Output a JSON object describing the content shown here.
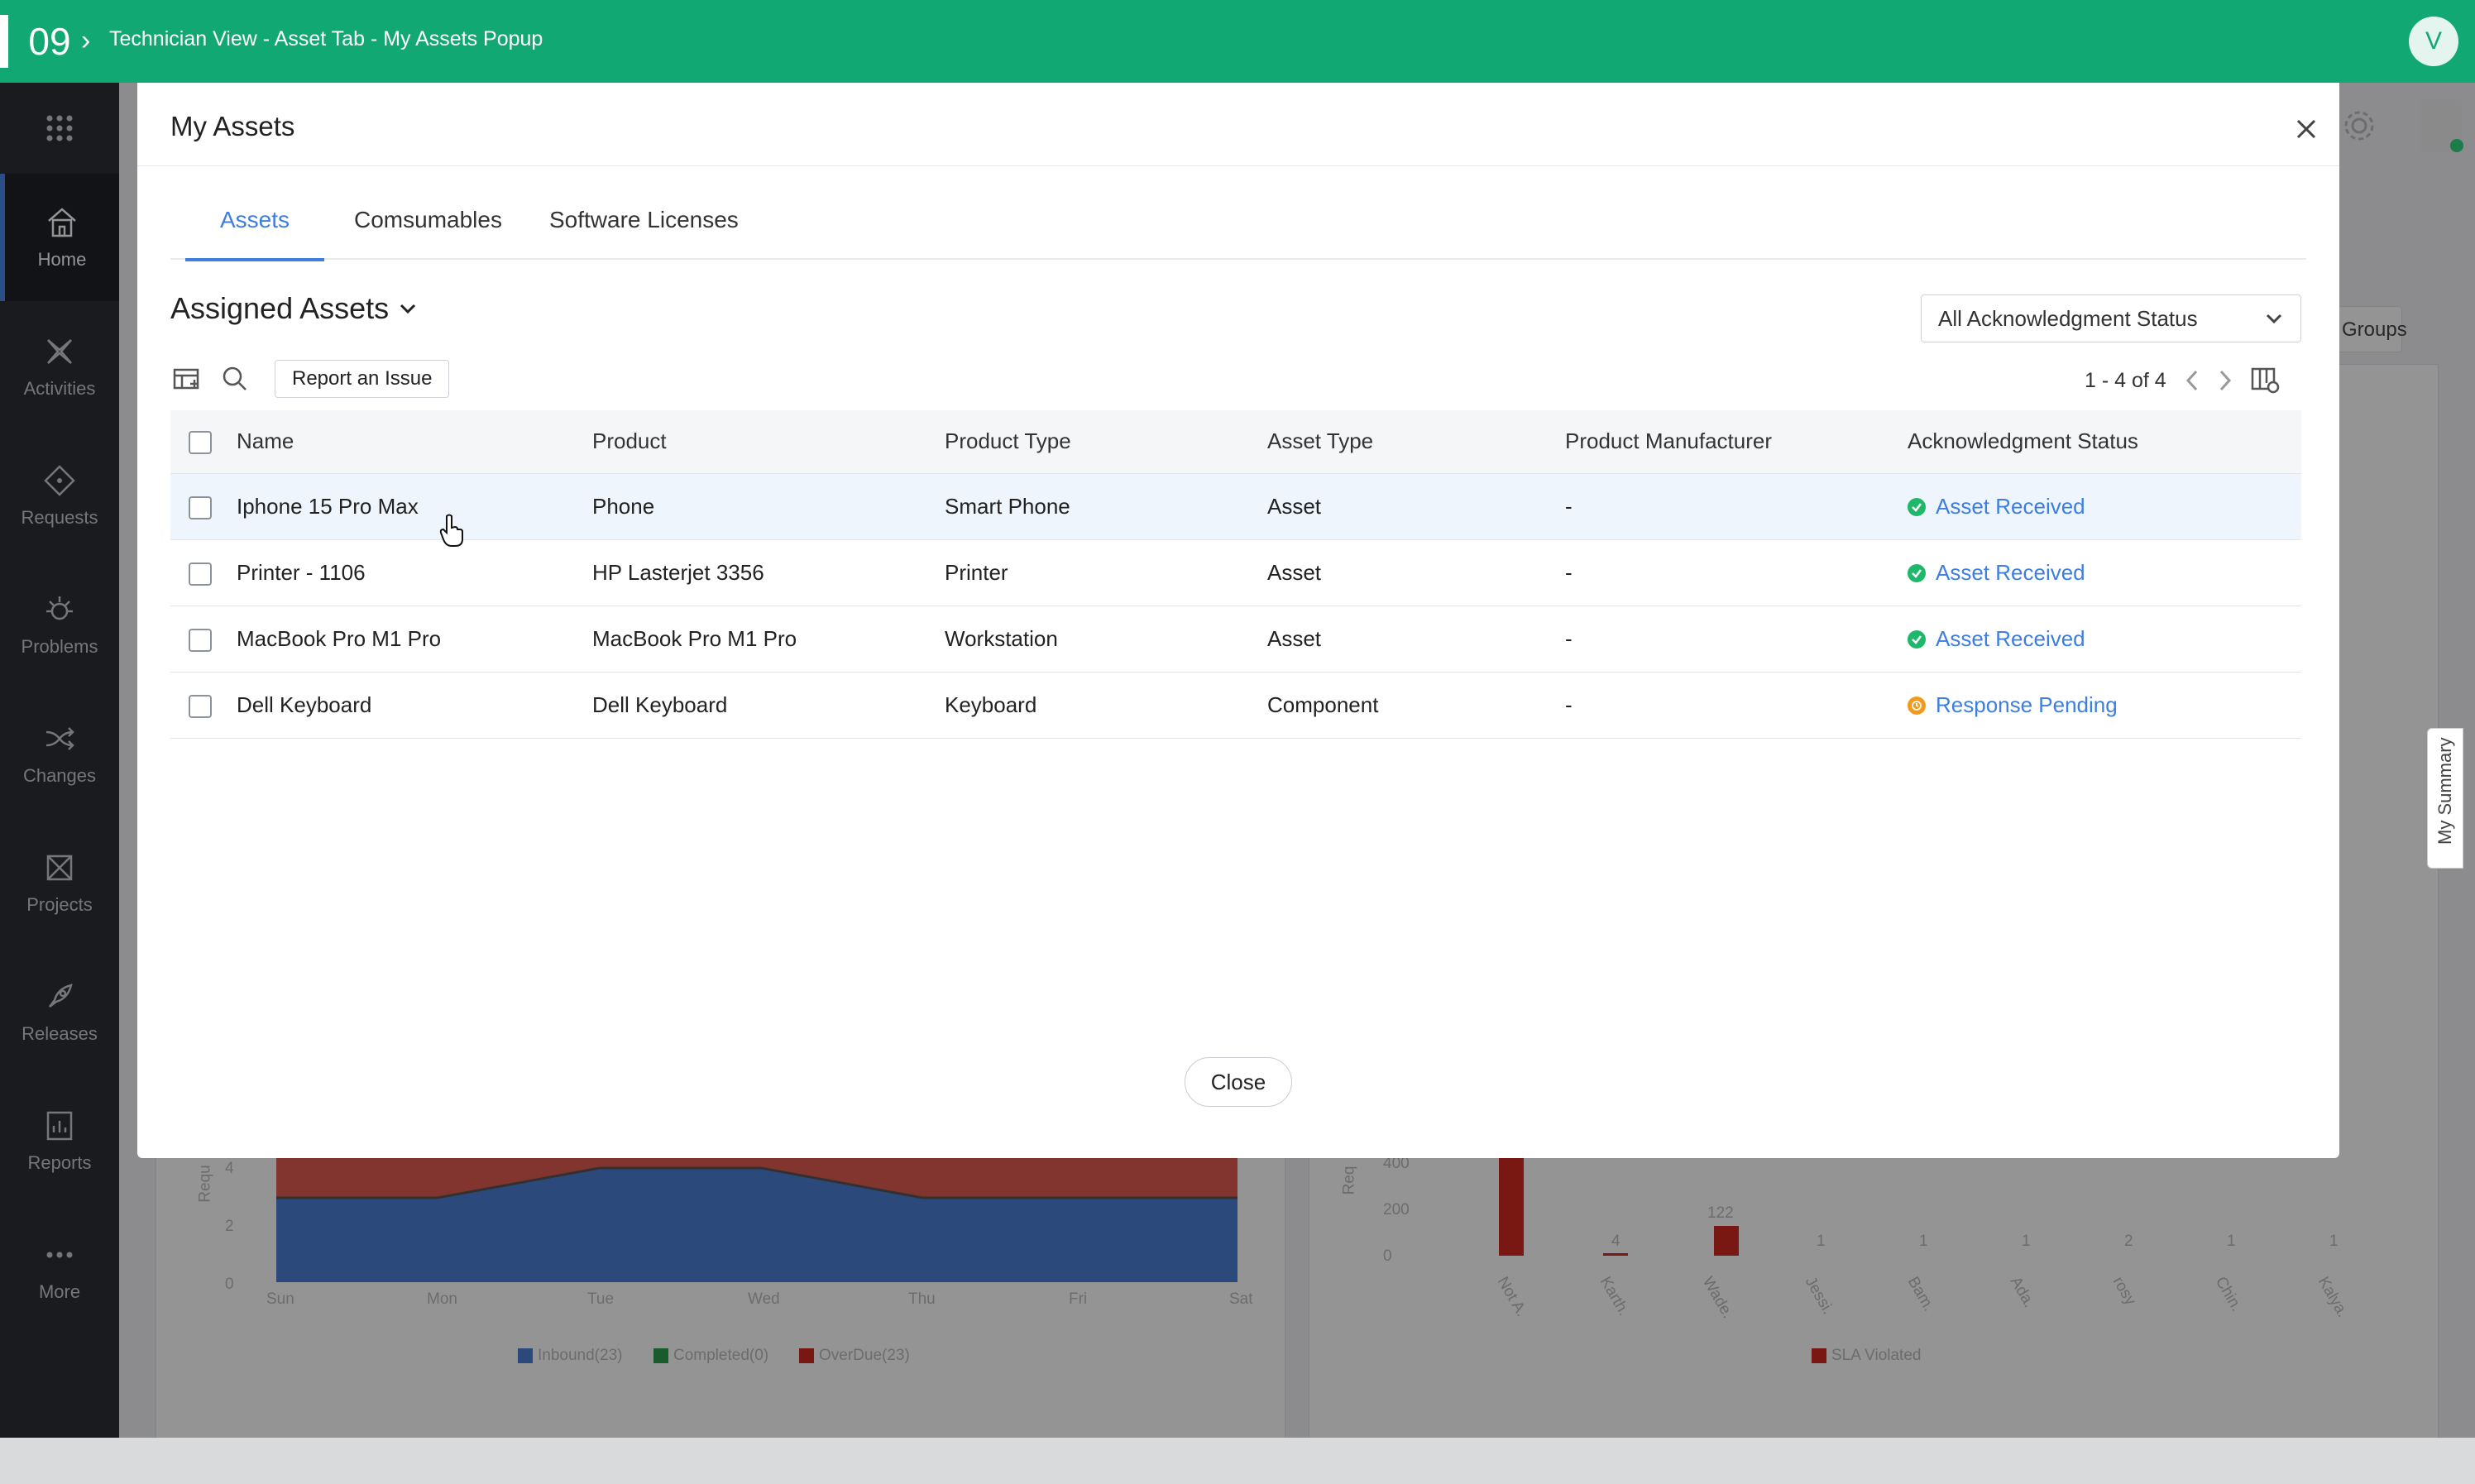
{
  "topbar": {
    "step": "09",
    "breadcrumb": "Technician View - Asset Tab - My Assets Popup",
    "avatar_initial": "V",
    "color": "#12a874"
  },
  "sidebar": {
    "items": [
      {
        "label": "Home",
        "icon": "home-icon",
        "active": true
      },
      {
        "label": "Activities",
        "icon": "activities-icon"
      },
      {
        "label": "Requests",
        "icon": "requests-icon"
      },
      {
        "label": "Problems",
        "icon": "problems-icon"
      },
      {
        "label": "Changes",
        "icon": "changes-icon"
      },
      {
        "label": "Projects",
        "icon": "projects-icon"
      },
      {
        "label": "Releases",
        "icon": "releases-icon"
      },
      {
        "label": "Reports",
        "icon": "reports-icon"
      },
      {
        "label": "More",
        "icon": "more-icon"
      }
    ]
  },
  "background": {
    "groups_label": "Groups",
    "my_summary": "My Summary",
    "left_chart": {
      "ylabel": "Requ",
      "yticks": [
        "4",
        "2",
        "0"
      ],
      "days": [
        "Sun",
        "Mon",
        "Tue",
        "Wed",
        "Thu",
        "Fri",
        "Sat"
      ],
      "legend": [
        "Inbound(23)",
        "Completed(0)",
        "OverDue(23)"
      ]
    },
    "right_chart": {
      "ylabel": "Req",
      "yticks": [
        "400",
        "200",
        "0"
      ],
      "values": [
        "4",
        "122",
        "1",
        "1",
        "1",
        "2",
        "1",
        "1"
      ],
      "names": [
        "Not A.",
        "Karth.",
        "Wade.",
        "Jessi.",
        "Bam.",
        "Ada.",
        "rosy",
        "Chin.",
        "Kalya."
      ],
      "legend": "SLA Violated"
    }
  },
  "modal": {
    "title": "My Assets",
    "tabs": [
      "Assets",
      "Comsumables",
      "Software Licenses"
    ],
    "active_tab": "Assets",
    "view_name": "Assigned Assets",
    "ack_filter": "All Acknowledgment Status",
    "report_button": "Report an Issue",
    "pagination": "1 - 4 of 4",
    "columns": [
      "Name",
      "Product",
      "Product Type",
      "Asset Type",
      "Product Manufacturer",
      "Acknowledgment Status"
    ],
    "rows": [
      {
        "name": "Iphone 15 Pro Max",
        "product": "Phone",
        "product_type": "Smart Phone",
        "asset_type": "Asset",
        "manufacturer": "-",
        "status": "Asset Received",
        "status_kind": "ok"
      },
      {
        "name": "Printer - 1106",
        "product": "HP Lasterjet 3356",
        "product_type": "Printer",
        "asset_type": "Asset",
        "manufacturer": "-",
        "status": "Asset Received",
        "status_kind": "ok"
      },
      {
        "name": "MacBook Pro M1 Pro",
        "product": "MacBook Pro M1 Pro",
        "product_type": "Workstation",
        "asset_type": "Asset",
        "manufacturer": "-",
        "status": "Asset Received",
        "status_kind": "ok"
      },
      {
        "name": "Dell Keyboard",
        "product": "Dell Keyboard",
        "product_type": "Keyboard",
        "asset_type": "Component",
        "manufacturer": "-",
        "status": "Response Pending",
        "status_kind": "pending"
      }
    ],
    "close_button": "Close",
    "accent": "#3d7ee0",
    "ok_color": "#1fb86a",
    "pending_color": "#f39a1c"
  }
}
